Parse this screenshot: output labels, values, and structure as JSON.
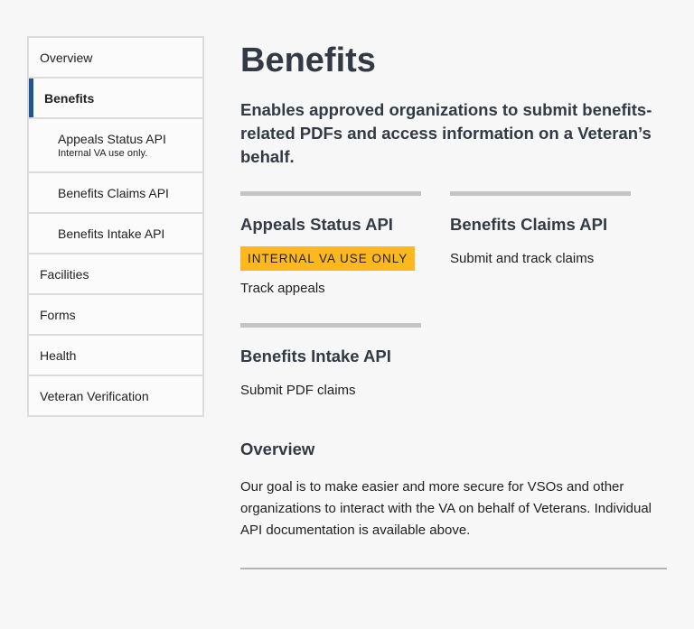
{
  "sidebar": {
    "items": [
      {
        "label": "Overview"
      },
      {
        "label": "Benefits"
      },
      {
        "label": "Appeals Status API",
        "note": "Internal VA use only."
      },
      {
        "label": "Benefits Claims API"
      },
      {
        "label": "Benefits Intake API"
      },
      {
        "label": "Facilities"
      },
      {
        "label": "Forms"
      },
      {
        "label": "Health"
      },
      {
        "label": "Veteran Verification"
      }
    ],
    "active_color": "#205493"
  },
  "main": {
    "title": "Benefits",
    "lead": "Enables approved organizations to submit benefits-related PDFs and access information on a Veteran’s behalf.",
    "cards": [
      {
        "title": "Appeals Status API",
        "badge": "INTERNAL VA USE ONLY",
        "description": "Track appeals"
      },
      {
        "title": "Benefits Claims API",
        "description": "Submit and track claims"
      },
      {
        "title": "Benefits Intake API",
        "description": "Submit PDF claims"
      }
    ],
    "overview": {
      "heading": "Overview",
      "text": "Our goal is to make easier and more secure for VSOs and other organizations to interact with the VA on behalf of Veterans. Individual API documentation is available above."
    }
  },
  "colors": {
    "badge": "#fdb81e",
    "text": "#323a45",
    "background": "#f7f7f7"
  }
}
